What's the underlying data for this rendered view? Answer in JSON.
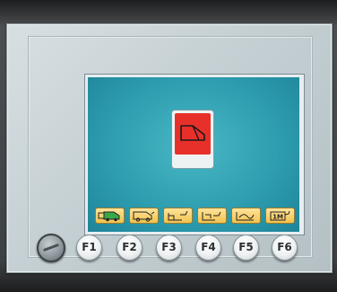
{
  "screen": {
    "center_indicator": {
      "icon": "vehicle-side-red-icon",
      "color": "#e8302a"
    },
    "softkeys": [
      {
        "icon": "van-active-icon",
        "active": true
      },
      {
        "icon": "van-outline-icon",
        "active": false
      },
      {
        "icon": "panel-mode-1-icon",
        "active": false
      },
      {
        "icon": "panel-mode-2-icon",
        "active": false
      },
      {
        "icon": "panel-mode-3-icon",
        "active": false
      },
      {
        "icon": "memory-1m-icon",
        "active": false,
        "label": "1M"
      }
    ]
  },
  "controls": {
    "knob": {
      "icon": "rotary-knob-icon"
    },
    "function_keys": [
      {
        "label": "F1"
      },
      {
        "label": "F2"
      },
      {
        "label": "F3"
      },
      {
        "label": "F4"
      },
      {
        "label": "F5"
      },
      {
        "label": "F6"
      }
    ]
  },
  "colors": {
    "screen": "#2e9eb0",
    "softkey": "#f2c24f",
    "indicator": "#e8302a",
    "active_van": "#3aa84a"
  }
}
